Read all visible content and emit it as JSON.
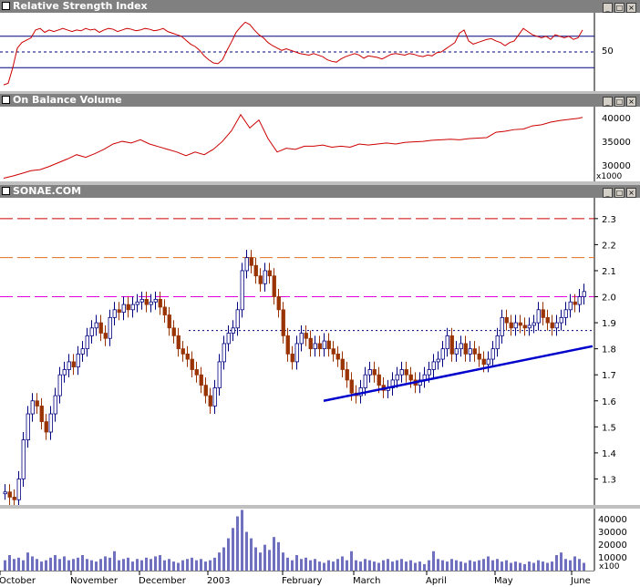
{
  "panels": {
    "rsi": {
      "title": "Relative Strength Index",
      "tick": "50"
    },
    "obv": {
      "title": "On Balance Volume",
      "ticks": [
        "40000",
        "35000",
        "30000"
      ],
      "scale": "x1000"
    },
    "price": {
      "title": "SONAE.COM",
      "ticks": [
        "2.3",
        "2.2",
        "2.1",
        "2.0",
        "1.9",
        "1.8",
        "1.7",
        "1.6",
        "1.5",
        "1.4",
        "1.3"
      ]
    },
    "volume": {
      "ticks": [
        "40000",
        "30000",
        "20000",
        "10000"
      ],
      "scale": "x100"
    }
  },
  "months": [
    "October",
    "November",
    "December",
    "2003",
    "February",
    "March",
    "April",
    "May",
    "June"
  ],
  "chart_data": [
    {
      "type": "line",
      "title": "Relative Strength Index",
      "x": [
        0,
        5,
        10,
        15,
        20,
        25,
        30,
        35,
        40,
        45,
        50,
        55,
        60,
        65,
        70,
        75,
        80,
        85,
        90,
        95,
        100,
        105,
        110,
        115,
        120,
        125,
        130,
        135,
        140,
        145,
        150,
        155,
        160,
        165,
        170,
        175,
        180,
        185,
        190,
        195,
        200,
        205,
        210,
        215,
        220,
        225,
        230,
        235,
        240,
        245,
        250,
        255,
        260,
        265,
        270,
        275,
        280,
        285,
        290,
        295,
        300,
        305,
        310,
        315,
        320,
        325,
        330,
        335,
        340,
        345,
        350,
        355,
        360,
        365,
        370,
        375,
        380,
        385,
        390,
        395,
        400,
        405,
        410,
        415,
        420,
        425,
        430,
        435,
        440,
        445,
        450,
        455,
        460,
        465,
        470,
        475,
        480,
        485,
        490,
        495,
        500,
        505,
        510,
        515,
        520,
        525,
        530,
        535,
        540,
        545,
        550,
        555,
        560,
        565,
        570,
        575,
        580,
        585,
        590,
        595,
        600,
        605,
        610,
        615,
        620,
        625,
        630,
        635
      ],
      "series": [
        {
          "values": [
            8,
            10,
            30,
            55,
            62,
            65,
            68,
            78,
            80,
            75,
            78,
            76,
            78,
            80,
            78,
            76,
            78,
            77,
            80,
            78,
            79,
            75,
            78,
            80,
            79,
            76,
            78,
            80,
            79,
            77,
            78,
            80,
            79,
            77,
            78,
            80,
            76,
            74,
            72,
            70,
            65,
            60,
            57,
            52,
            45,
            40,
            36,
            35,
            40,
            52,
            63,
            75,
            82,
            88,
            85,
            78,
            72,
            68,
            62,
            58,
            55,
            52,
            54,
            52,
            50,
            48,
            47,
            46,
            48,
            46,
            44,
            40,
            38,
            37,
            41,
            44,
            46,
            48,
            46,
            42,
            45,
            44,
            43,
            41,
            44,
            47,
            48,
            47,
            46,
            48,
            47,
            45,
            44,
            46,
            45,
            49,
            50,
            54,
            58,
            62,
            74,
            78,
            64,
            60,
            62,
            64,
            66,
            67,
            64,
            62,
            58,
            62,
            64,
            72,
            80,
            76,
            72,
            70,
            68,
            70,
            66,
            72,
            70,
            68,
            70,
            66,
            68,
            78
          ]
        }
      ],
      "ylim": [
        0,
        100
      ],
      "reference_lines": [
        70,
        50,
        30
      ],
      "grid": false
    },
    {
      "type": "line",
      "title": "On Balance Volume",
      "ylabel": "x1000",
      "x": [
        0,
        10,
        20,
        30,
        40,
        50,
        60,
        70,
        80,
        90,
        100,
        110,
        120,
        130,
        140,
        150,
        160,
        170,
        180,
        190,
        200,
        210,
        220,
        230,
        240,
        250,
        260,
        270,
        280,
        290,
        300,
        310,
        320,
        330,
        340,
        350,
        360,
        370,
        380,
        390,
        400,
        410,
        420,
        430,
        440,
        450,
        460,
        470,
        480,
        490,
        500,
        510,
        520,
        530,
        540,
        550,
        560,
        570,
        580,
        590,
        600,
        610,
        620,
        630,
        635
      ],
      "series": [
        {
          "values": [
            28600,
            29000,
            29500,
            30000,
            30200,
            30800,
            31500,
            32200,
            33000,
            32500,
            33200,
            34000,
            35000,
            35500,
            35200,
            35800,
            35000,
            34500,
            34000,
            33500,
            32800,
            33500,
            33000,
            34000,
            35500,
            37500,
            40500,
            38000,
            39500,
            36000,
            33500,
            34200,
            34000,
            34600,
            34600,
            34800,
            34400,
            34600,
            34400,
            35000,
            34800,
            35000,
            35200,
            35000,
            35300,
            35400,
            35500,
            35700,
            35800,
            35900,
            35800,
            36000,
            36100,
            36200,
            37200,
            37400,
            37700,
            37800,
            38400,
            38600,
            39100,
            39400,
            39600,
            39800,
            40000
          ]
        }
      ],
      "ylim": [
        28000,
        42000
      ],
      "grid": false
    },
    {
      "type": "candlestick",
      "title": "SONAE.COM",
      "x": [
        0,
        5,
        10,
        15,
        20,
        25,
        30,
        35,
        40,
        45,
        50,
        55,
        60,
        65,
        70,
        75,
        80,
        85,
        90,
        95,
        100,
        105,
        110,
        115,
        120,
        125,
        130,
        135,
        140,
        145,
        150,
        155,
        160,
        165,
        170,
        175,
        180,
        185,
        190,
        195,
        200,
        205,
        210,
        215,
        220,
        225,
        230,
        235,
        240,
        245,
        250,
        255,
        260,
        265,
        270,
        275,
        280,
        285,
        290,
        295,
        300,
        305,
        310,
        315,
        320,
        325,
        330,
        335,
        340,
        345,
        350,
        355,
        360,
        365,
        370,
        375,
        380,
        385,
        390,
        395,
        400,
        405,
        410,
        415,
        420,
        425,
        430,
        435,
        440,
        445,
        450,
        455,
        460,
        465,
        470,
        475,
        480,
        485,
        490,
        495,
        500,
        505,
        510,
        515,
        520,
        525,
        530,
        535,
        540,
        545,
        550,
        555,
        560,
        565,
        570,
        575,
        580,
        585,
        590,
        595,
        600,
        605,
        610,
        615,
        620,
        625,
        630,
        635
      ],
      "series": [
        {
          "values": [
            1.25,
            1.23,
            1.22,
            1.3,
            1.45,
            1.55,
            1.6,
            1.58,
            1.52,
            1.48,
            1.55,
            1.62,
            1.7,
            1.72,
            1.75,
            1.73,
            1.78,
            1.8,
            1.85,
            1.88,
            1.9,
            1.86,
            1.84,
            1.92,
            1.95,
            1.94,
            1.97,
            1.95,
            1.97,
            1.98,
            1.99,
            1.97,
            1.98,
            1.99,
            1.96,
            1.93,
            1.88,
            1.85,
            1.8,
            1.78,
            1.76,
            1.72,
            1.7,
            1.66,
            1.62,
            1.58,
            1.65,
            1.75,
            1.82,
            1.86,
            1.88,
            1.95,
            2.1,
            2.15,
            2.12,
            2.08,
            2.05,
            2.1,
            2.08,
            2.0,
            1.95,
            1.85,
            1.78,
            1.75,
            1.82,
            1.86,
            1.84,
            1.8,
            1.82,
            1.8,
            1.83,
            1.8,
            1.78,
            1.76,
            1.72,
            1.68,
            1.63,
            1.62,
            1.65,
            1.7,
            1.72,
            1.7,
            1.66,
            1.64,
            1.65,
            1.68,
            1.7,
            1.72,
            1.7,
            1.68,
            1.66,
            1.68,
            1.7,
            1.72,
            1.75,
            1.76,
            1.8,
            1.85,
            1.78,
            1.8,
            1.82,
            1.78,
            1.8,
            1.78,
            1.76,
            1.74,
            1.76,
            1.8,
            1.85,
            1.92,
            1.9,
            1.88,
            1.9,
            1.89,
            1.88,
            1.89,
            1.9,
            1.95,
            1.92,
            1.9,
            1.88,
            1.9,
            1.92,
            1.95,
            1.98,
            1.97,
            2.0,
            2.02
          ]
        }
      ],
      "ylim": [
        1.2,
        2.38
      ],
      "reference_lines": [
        {
          "value": 2.3,
          "color": "#cc0000",
          "style": "dashed"
        },
        {
          "value": 2.15,
          "color": "#e07020",
          "style": "dashed"
        },
        {
          "value": 2.0,
          "color": "#e000e0",
          "style": "dashed"
        },
        {
          "value": 1.87,
          "color": "#000080",
          "style": "dotted",
          "from": 207
        }
      ],
      "trendline": {
        "from": {
          "x": 355,
          "y": 1.6
        },
        "to": {
          "x": 650,
          "y": 1.81
        },
        "color": "#0000cc"
      },
      "up_color": "#000080",
      "down_color": "#993300",
      "grid": false
    },
    {
      "type": "bar",
      "title": "",
      "ylabel": "x100",
      "x": [
        0,
        5,
        10,
        15,
        20,
        25,
        30,
        35,
        40,
        45,
        50,
        55,
        60,
        65,
        70,
        75,
        80,
        85,
        90,
        95,
        100,
        105,
        110,
        115,
        120,
        125,
        130,
        135,
        140,
        145,
        150,
        155,
        160,
        165,
        170,
        175,
        180,
        185,
        190,
        195,
        200,
        205,
        210,
        215,
        220,
        225,
        230,
        235,
        240,
        245,
        250,
        255,
        260,
        265,
        270,
        275,
        280,
        285,
        290,
        295,
        300,
        305,
        310,
        315,
        320,
        325,
        330,
        335,
        340,
        345,
        350,
        355,
        360,
        365,
        370,
        375,
        380,
        385,
        390,
        395,
        400,
        405,
        410,
        415,
        420,
        425,
        430,
        435,
        440,
        445,
        450,
        455,
        460,
        465,
        470,
        475,
        480,
        485,
        490,
        495,
        500,
        505,
        510,
        515,
        520,
        525,
        530,
        535,
        540,
        545,
        550,
        555,
        560,
        565,
        570,
        575,
        580,
        585,
        590,
        595,
        600,
        605,
        610,
        615,
        620,
        625,
        630,
        635
      ],
      "series": [
        {
          "values": [
            8000,
            12000,
            9000,
            10000,
            8000,
            14000,
            11000,
            9000,
            7000,
            8000,
            10000,
            12000,
            9000,
            11000,
            8000,
            9000,
            10000,
            12000,
            9000,
            8000,
            7000,
            9000,
            11000,
            10000,
            15000,
            8000,
            9000,
            10000,
            7000,
            9000,
            8000,
            10000,
            9000,
            11000,
            12000,
            8000,
            9000,
            7000,
            6000,
            8000,
            9000,
            10000,
            8000,
            9000,
            7000,
            8000,
            10000,
            14000,
            18000,
            25000,
            33000,
            42000,
            47000,
            30000,
            25000,
            18000,
            14000,
            20000,
            16000,
            26000,
            22000,
            14000,
            10000,
            8000,
            12000,
            9000,
            10000,
            8000,
            9000,
            7000,
            6000,
            8000,
            7000,
            9000,
            11000,
            8000,
            15000,
            8000,
            7000,
            9000,
            8000,
            7000,
            6000,
            8000,
            9000,
            7000,
            8000,
            9000,
            7000,
            8000,
            6000,
            7000,
            5000,
            8000,
            15000,
            9000,
            8000,
            7000,
            9000,
            8000,
            7000,
            6000,
            8000,
            7000,
            8000,
            9000,
            11000,
            8000,
            9000,
            7000,
            8000,
            6000,
            7000,
            6000,
            5000,
            7000,
            6000,
            8000,
            7000,
            6000,
            7000,
            12000,
            14000,
            9000,
            8000,
            11000,
            9000,
            6000
          ]
        }
      ],
      "ylim": [
        0,
        48000
      ],
      "grid": false
    }
  ]
}
